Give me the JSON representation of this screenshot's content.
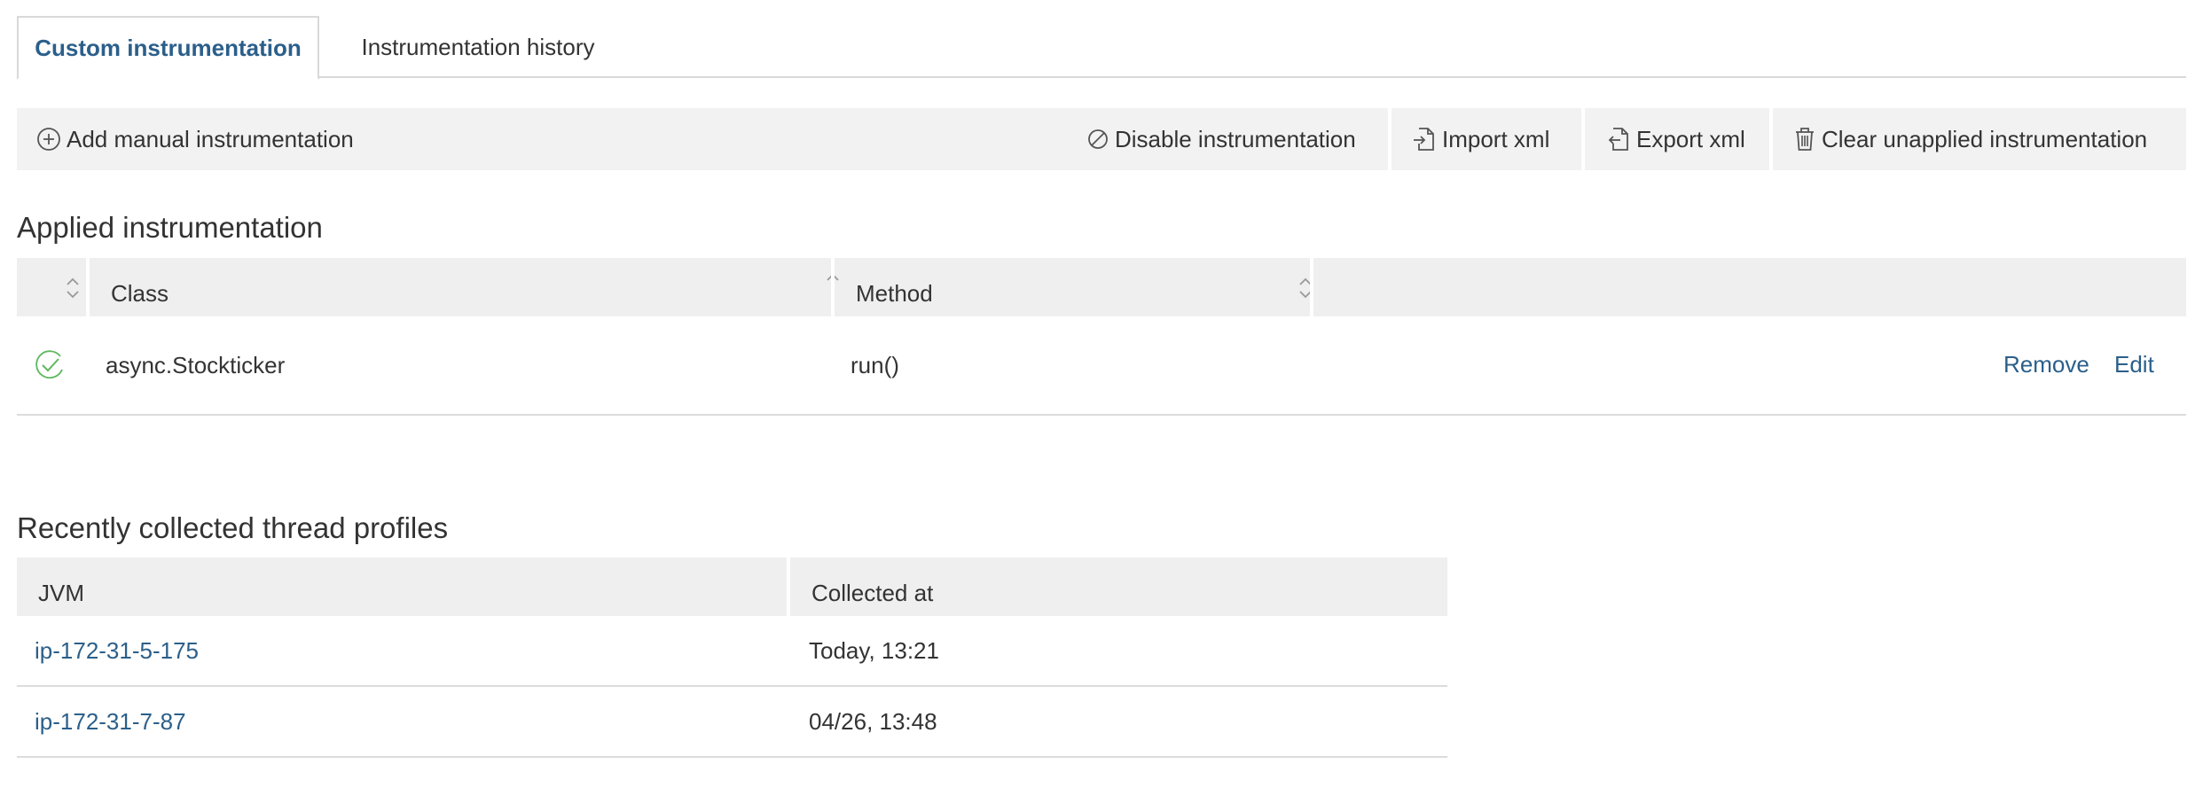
{
  "tabs": [
    {
      "label": "Custom instrumentation",
      "active": true
    },
    {
      "label": "Instrumentation history",
      "active": false
    }
  ],
  "toolbar": {
    "add_label": "Add manual instrumentation",
    "disable_label": "Disable instrumentation",
    "import_label": "Import xml",
    "export_label": "Export xml",
    "clear_label": "Clear unapplied instrumentation"
  },
  "applied": {
    "title": "Applied instrumentation",
    "columns": [
      "Class",
      "Method"
    ],
    "rows": [
      {
        "status_icon": "check-circle-icon",
        "class": "async.Stockticker",
        "method": "run()",
        "remove_label": "Remove",
        "edit_label": "Edit"
      }
    ]
  },
  "profiles": {
    "title": "Recently collected thread profiles",
    "columns": [
      "JVM",
      "Collected at"
    ],
    "rows": [
      {
        "jvm": "ip-172-31-5-175",
        "collected_at": "Today, 13:21"
      },
      {
        "jvm": "ip-172-31-7-87",
        "collected_at": "04/26, 13:48"
      }
    ]
  },
  "colors": {
    "accent": "#2b5f8a",
    "success": "#5cb85c",
    "header_bg": "#efefef",
    "toolbar_bg": "#f2f2f2"
  }
}
